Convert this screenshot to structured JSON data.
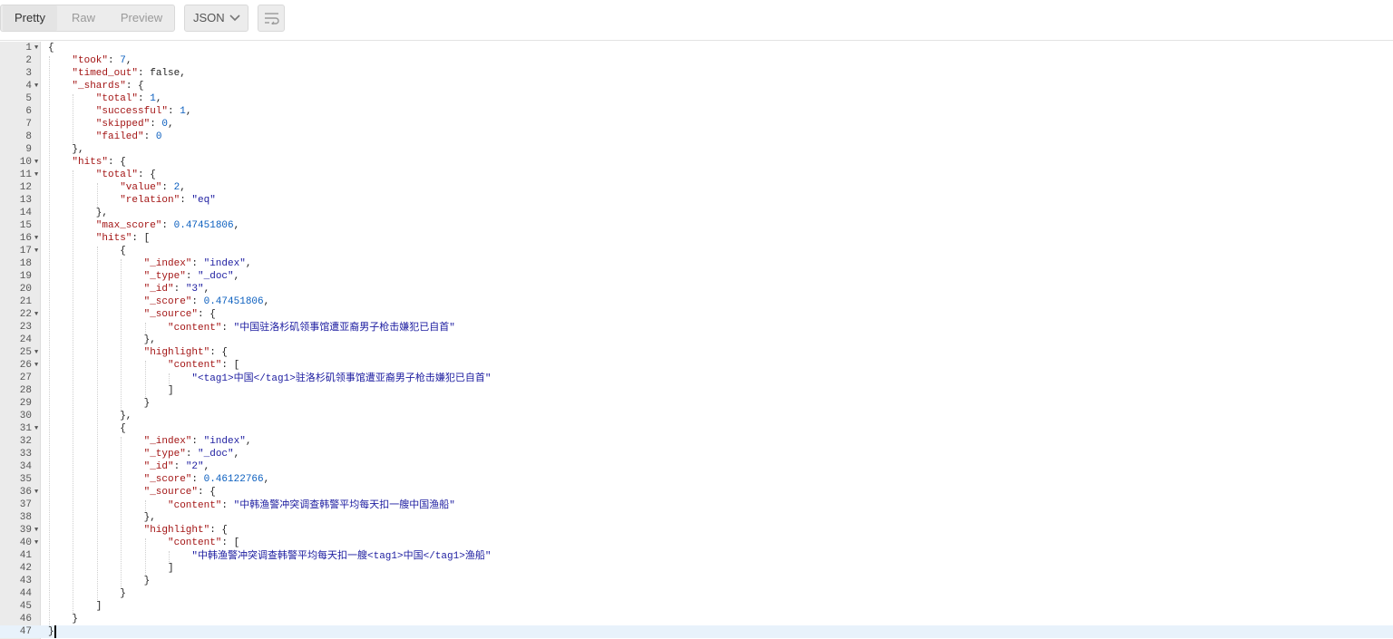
{
  "toolbar": {
    "tabs": [
      "Pretty",
      "Raw",
      "Preview"
    ],
    "active_tab": "Pretty",
    "format_label": "JSON",
    "format_icon": "chevron-down-icon",
    "wrap_icon": "wrap-lines-icon"
  },
  "editor": {
    "current_line": 47,
    "fold_lines": [
      1,
      4,
      10,
      11,
      16,
      17,
      22,
      25,
      26,
      31,
      36,
      39,
      40
    ],
    "lines": [
      {
        "indent": 0,
        "tokens": [
          {
            "t": "p",
            "v": "{"
          }
        ]
      },
      {
        "indent": 1,
        "tokens": [
          {
            "t": "k",
            "v": "\"took\""
          },
          {
            "t": "p",
            "v": ": "
          },
          {
            "t": "n",
            "v": "7"
          },
          {
            "t": "p",
            "v": ","
          }
        ]
      },
      {
        "indent": 1,
        "tokens": [
          {
            "t": "k",
            "v": "\"timed_out\""
          },
          {
            "t": "p",
            "v": ": "
          },
          {
            "t": "kw",
            "v": "false"
          },
          {
            "t": "p",
            "v": ","
          }
        ]
      },
      {
        "indent": 1,
        "tokens": [
          {
            "t": "k",
            "v": "\"_shards\""
          },
          {
            "t": "p",
            "v": ": {"
          }
        ]
      },
      {
        "indent": 2,
        "tokens": [
          {
            "t": "k",
            "v": "\"total\""
          },
          {
            "t": "p",
            "v": ": "
          },
          {
            "t": "n",
            "v": "1"
          },
          {
            "t": "p",
            "v": ","
          }
        ]
      },
      {
        "indent": 2,
        "tokens": [
          {
            "t": "k",
            "v": "\"successful\""
          },
          {
            "t": "p",
            "v": ": "
          },
          {
            "t": "n",
            "v": "1"
          },
          {
            "t": "p",
            "v": ","
          }
        ]
      },
      {
        "indent": 2,
        "tokens": [
          {
            "t": "k",
            "v": "\"skipped\""
          },
          {
            "t": "p",
            "v": ": "
          },
          {
            "t": "n",
            "v": "0"
          },
          {
            "t": "p",
            "v": ","
          }
        ]
      },
      {
        "indent": 2,
        "tokens": [
          {
            "t": "k",
            "v": "\"failed\""
          },
          {
            "t": "p",
            "v": ": "
          },
          {
            "t": "n",
            "v": "0"
          }
        ]
      },
      {
        "indent": 1,
        "tokens": [
          {
            "t": "p",
            "v": "},"
          }
        ]
      },
      {
        "indent": 1,
        "tokens": [
          {
            "t": "k",
            "v": "\"hits\""
          },
          {
            "t": "p",
            "v": ": {"
          }
        ]
      },
      {
        "indent": 2,
        "tokens": [
          {
            "t": "k",
            "v": "\"total\""
          },
          {
            "t": "p",
            "v": ": {"
          }
        ]
      },
      {
        "indent": 3,
        "tokens": [
          {
            "t": "k",
            "v": "\"value\""
          },
          {
            "t": "p",
            "v": ": "
          },
          {
            "t": "n",
            "v": "2"
          },
          {
            "t": "p",
            "v": ","
          }
        ]
      },
      {
        "indent": 3,
        "tokens": [
          {
            "t": "k",
            "v": "\"relation\""
          },
          {
            "t": "p",
            "v": ": "
          },
          {
            "t": "s",
            "v": "\"eq\""
          }
        ]
      },
      {
        "indent": 2,
        "tokens": [
          {
            "t": "p",
            "v": "},"
          }
        ]
      },
      {
        "indent": 2,
        "tokens": [
          {
            "t": "k",
            "v": "\"max_score\""
          },
          {
            "t": "p",
            "v": ": "
          },
          {
            "t": "n",
            "v": "0.47451806"
          },
          {
            "t": "p",
            "v": ","
          }
        ]
      },
      {
        "indent": 2,
        "tokens": [
          {
            "t": "k",
            "v": "\"hits\""
          },
          {
            "t": "p",
            "v": ": ["
          }
        ]
      },
      {
        "indent": 3,
        "tokens": [
          {
            "t": "p",
            "v": "{"
          }
        ]
      },
      {
        "indent": 4,
        "tokens": [
          {
            "t": "k",
            "v": "\"_index\""
          },
          {
            "t": "p",
            "v": ": "
          },
          {
            "t": "s",
            "v": "\"index\""
          },
          {
            "t": "p",
            "v": ","
          }
        ]
      },
      {
        "indent": 4,
        "tokens": [
          {
            "t": "k",
            "v": "\"_type\""
          },
          {
            "t": "p",
            "v": ": "
          },
          {
            "t": "s",
            "v": "\"_doc\""
          },
          {
            "t": "p",
            "v": ","
          }
        ]
      },
      {
        "indent": 4,
        "tokens": [
          {
            "t": "k",
            "v": "\"_id\""
          },
          {
            "t": "p",
            "v": ": "
          },
          {
            "t": "s",
            "v": "\"3\""
          },
          {
            "t": "p",
            "v": ","
          }
        ]
      },
      {
        "indent": 4,
        "tokens": [
          {
            "t": "k",
            "v": "\"_score\""
          },
          {
            "t": "p",
            "v": ": "
          },
          {
            "t": "n",
            "v": "0.47451806"
          },
          {
            "t": "p",
            "v": ","
          }
        ]
      },
      {
        "indent": 4,
        "tokens": [
          {
            "t": "k",
            "v": "\"_source\""
          },
          {
            "t": "p",
            "v": ": {"
          }
        ]
      },
      {
        "indent": 5,
        "tokens": [
          {
            "t": "k",
            "v": "\"content\""
          },
          {
            "t": "p",
            "v": ": "
          },
          {
            "t": "s",
            "v": "\""
          },
          {
            "t": "cjk",
            "v": "中国驻洛杉矶领事馆遭亚裔男子枪击嫌犯已自首"
          },
          {
            "t": "s",
            "v": "\""
          }
        ]
      },
      {
        "indent": 4,
        "tokens": [
          {
            "t": "p",
            "v": "},"
          }
        ]
      },
      {
        "indent": 4,
        "tokens": [
          {
            "t": "k",
            "v": "\"highlight\""
          },
          {
            "t": "p",
            "v": ": {"
          }
        ]
      },
      {
        "indent": 5,
        "tokens": [
          {
            "t": "k",
            "v": "\"content\""
          },
          {
            "t": "p",
            "v": ": ["
          }
        ]
      },
      {
        "indent": 6,
        "tokens": [
          {
            "t": "s",
            "v": "\"<tag1>"
          },
          {
            "t": "cjk",
            "v": "中国"
          },
          {
            "t": "s",
            "v": "</tag1>"
          },
          {
            "t": "cjk",
            "v": "驻洛杉矶领事馆遭亚裔男子枪击嫌犯已自首"
          },
          {
            "t": "s",
            "v": "\""
          }
        ]
      },
      {
        "indent": 5,
        "tokens": [
          {
            "t": "p",
            "v": "]"
          }
        ]
      },
      {
        "indent": 4,
        "tokens": [
          {
            "t": "p",
            "v": "}"
          }
        ]
      },
      {
        "indent": 3,
        "tokens": [
          {
            "t": "p",
            "v": "},"
          }
        ]
      },
      {
        "indent": 3,
        "tokens": [
          {
            "t": "p",
            "v": "{"
          }
        ]
      },
      {
        "indent": 4,
        "tokens": [
          {
            "t": "k",
            "v": "\"_index\""
          },
          {
            "t": "p",
            "v": ": "
          },
          {
            "t": "s",
            "v": "\"index\""
          },
          {
            "t": "p",
            "v": ","
          }
        ]
      },
      {
        "indent": 4,
        "tokens": [
          {
            "t": "k",
            "v": "\"_type\""
          },
          {
            "t": "p",
            "v": ": "
          },
          {
            "t": "s",
            "v": "\"_doc\""
          },
          {
            "t": "p",
            "v": ","
          }
        ]
      },
      {
        "indent": 4,
        "tokens": [
          {
            "t": "k",
            "v": "\"_id\""
          },
          {
            "t": "p",
            "v": ": "
          },
          {
            "t": "s",
            "v": "\"2\""
          },
          {
            "t": "p",
            "v": ","
          }
        ]
      },
      {
        "indent": 4,
        "tokens": [
          {
            "t": "k",
            "v": "\"_score\""
          },
          {
            "t": "p",
            "v": ": "
          },
          {
            "t": "n",
            "v": "0.46122766"
          },
          {
            "t": "p",
            "v": ","
          }
        ]
      },
      {
        "indent": 4,
        "tokens": [
          {
            "t": "k",
            "v": "\"_source\""
          },
          {
            "t": "p",
            "v": ": {"
          }
        ]
      },
      {
        "indent": 5,
        "tokens": [
          {
            "t": "k",
            "v": "\"content\""
          },
          {
            "t": "p",
            "v": ": "
          },
          {
            "t": "s",
            "v": "\""
          },
          {
            "t": "cjk",
            "v": "中韩渔警冲突调查韩警平均每天扣一艘中国渔船"
          },
          {
            "t": "s",
            "v": "\""
          }
        ]
      },
      {
        "indent": 4,
        "tokens": [
          {
            "t": "p",
            "v": "},"
          }
        ]
      },
      {
        "indent": 4,
        "tokens": [
          {
            "t": "k",
            "v": "\"highlight\""
          },
          {
            "t": "p",
            "v": ": {"
          }
        ]
      },
      {
        "indent": 5,
        "tokens": [
          {
            "t": "k",
            "v": "\"content\""
          },
          {
            "t": "p",
            "v": ": ["
          }
        ]
      },
      {
        "indent": 6,
        "tokens": [
          {
            "t": "s",
            "v": "\""
          },
          {
            "t": "cjk",
            "v": "中韩渔警冲突调查韩警平均每天扣一艘"
          },
          {
            "t": "s",
            "v": "<tag1>"
          },
          {
            "t": "cjk",
            "v": "中国"
          },
          {
            "t": "s",
            "v": "</tag1>"
          },
          {
            "t": "cjk",
            "v": "渔船"
          },
          {
            "t": "s",
            "v": "\""
          }
        ]
      },
      {
        "indent": 5,
        "tokens": [
          {
            "t": "p",
            "v": "]"
          }
        ]
      },
      {
        "indent": 4,
        "tokens": [
          {
            "t": "p",
            "v": "}"
          }
        ]
      },
      {
        "indent": 3,
        "tokens": [
          {
            "t": "p",
            "v": "}"
          }
        ]
      },
      {
        "indent": 2,
        "tokens": [
          {
            "t": "p",
            "v": "]"
          }
        ]
      },
      {
        "indent": 1,
        "tokens": [
          {
            "t": "p",
            "v": "}"
          }
        ]
      },
      {
        "indent": 0,
        "tokens": [
          {
            "t": "p",
            "v": "}"
          }
        ]
      }
    ]
  }
}
